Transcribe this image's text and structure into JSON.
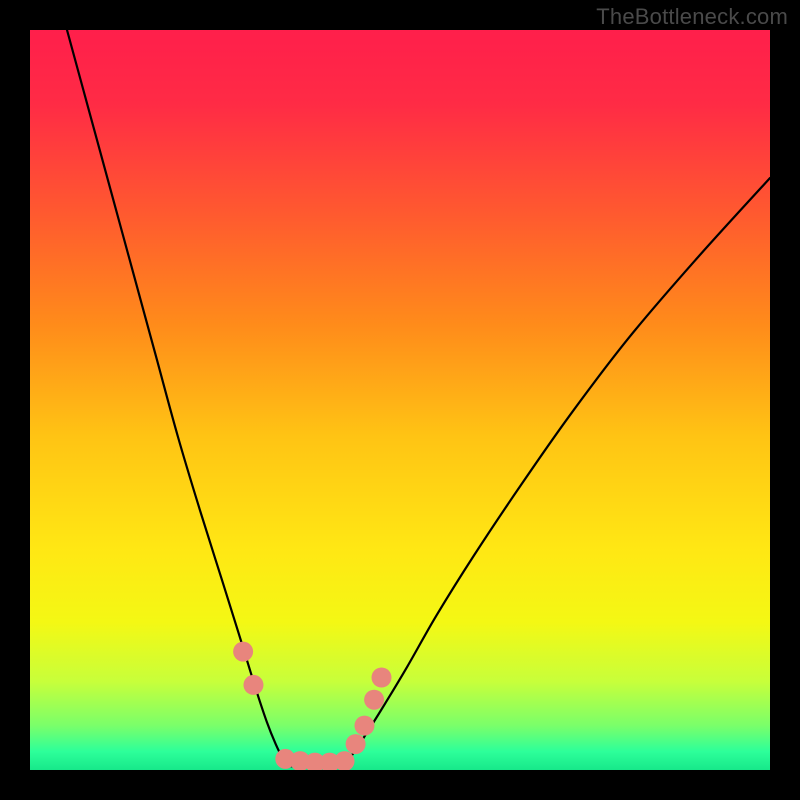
{
  "watermark": "TheBottleneck.com",
  "chart_data": {
    "type": "line",
    "title": "",
    "xlabel": "",
    "ylabel": "",
    "xlim": [
      0,
      100
    ],
    "ylim": [
      0,
      100
    ],
    "gradient_stops": [
      {
        "offset": 0.0,
        "color": "#ff1f4b"
      },
      {
        "offset": 0.1,
        "color": "#ff2b45"
      },
      {
        "offset": 0.25,
        "color": "#ff5a2f"
      },
      {
        "offset": 0.4,
        "color": "#ff8c1a"
      },
      {
        "offset": 0.55,
        "color": "#ffc414"
      },
      {
        "offset": 0.7,
        "color": "#ffe714"
      },
      {
        "offset": 0.8,
        "color": "#f4f814"
      },
      {
        "offset": 0.88,
        "color": "#c8ff3a"
      },
      {
        "offset": 0.94,
        "color": "#7aff6a"
      },
      {
        "offset": 0.975,
        "color": "#2dff9a"
      },
      {
        "offset": 1.0,
        "color": "#17e88a"
      }
    ],
    "series": [
      {
        "name": "left-arm",
        "x": [
          5,
          8,
          11,
          14,
          17,
          20,
          23,
          26,
          28.5,
          30.5,
          32,
          33.2,
          34.2,
          35
        ],
        "y": [
          100,
          89,
          78,
          67,
          56,
          45,
          35,
          25.5,
          17.5,
          11,
          6.5,
          3.5,
          1.5,
          0.5
        ]
      },
      {
        "name": "right-arm",
        "x": [
          42,
          43.5,
          45.5,
          48,
          51,
          55,
          60,
          66,
          73,
          81,
          90,
          100
        ],
        "y": [
          0.5,
          2,
          5,
          9,
          14,
          21,
          29,
          38,
          48,
          58.5,
          69,
          80
        ]
      }
    ],
    "flat_bottom": {
      "x_start": 35,
      "x_end": 42,
      "y": 0.5
    },
    "markers": {
      "color": "#e8857d",
      "radius_px": 10,
      "points": [
        {
          "x": 28.8,
          "y": 16
        },
        {
          "x": 30.2,
          "y": 11.5
        },
        {
          "x": 34.5,
          "y": 1.5
        },
        {
          "x": 36.5,
          "y": 1.2
        },
        {
          "x": 38.5,
          "y": 1.0
        },
        {
          "x": 40.5,
          "y": 1.0
        },
        {
          "x": 42.5,
          "y": 1.2
        },
        {
          "x": 44.0,
          "y": 3.5
        },
        {
          "x": 45.2,
          "y": 6.0
        },
        {
          "x": 46.5,
          "y": 9.5
        },
        {
          "x": 47.5,
          "y": 12.5
        }
      ]
    }
  }
}
